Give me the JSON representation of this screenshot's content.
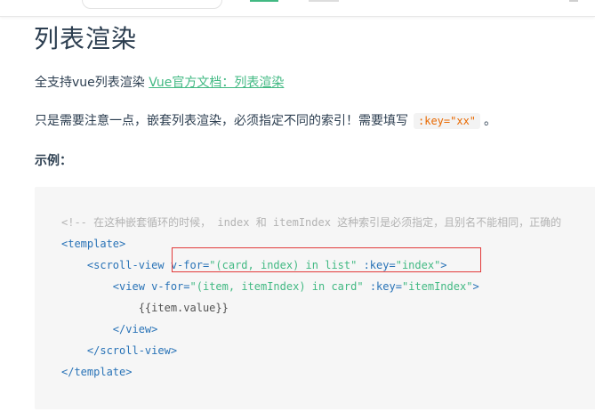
{
  "header": {
    "title": "列表渲染"
  },
  "intro": {
    "text": "全支持vue列表渲染 ",
    "link_text": "Vue官方文档：列表渲染"
  },
  "note": {
    "text_before": "只是需要注意一点，嵌套列表渲染，必须指定不同的索引！需要填写",
    "code": ":key=\"xx\"",
    "text_after": "。"
  },
  "example_label": "示例：",
  "code": {
    "comment": "<!-- 在这种嵌套循环的时候， index 和 itemIndex 这种索引是必须指定，且别名不能相同，正确的",
    "line2": "<template>",
    "line3_indent": "    ",
    "line3_tag_open": "<scroll-view ",
    "line3_attr1": "v-for=",
    "line3_val1": "\"(card, index) in list\"",
    "line3_attr2": " :key=",
    "line3_val2": "\"index\"",
    "line3_close": ">",
    "line4_indent": "        ",
    "line4_tag_open": "<view ",
    "line4_attr1": "v-for=",
    "line4_val1": "\"(item, itemIndex) in card\"",
    "line4_attr2": " :key=",
    "line4_val2": "\"itemIndex\"",
    "line4_close": ">",
    "line5": "            {{item.value}}",
    "line6": "        </view>",
    "line7": "    </scroll-view>",
    "line8": "</template>"
  },
  "colors": {
    "accent": "#42b983",
    "highlight_border": "#e23b3b",
    "inline_code": "#e96900"
  }
}
